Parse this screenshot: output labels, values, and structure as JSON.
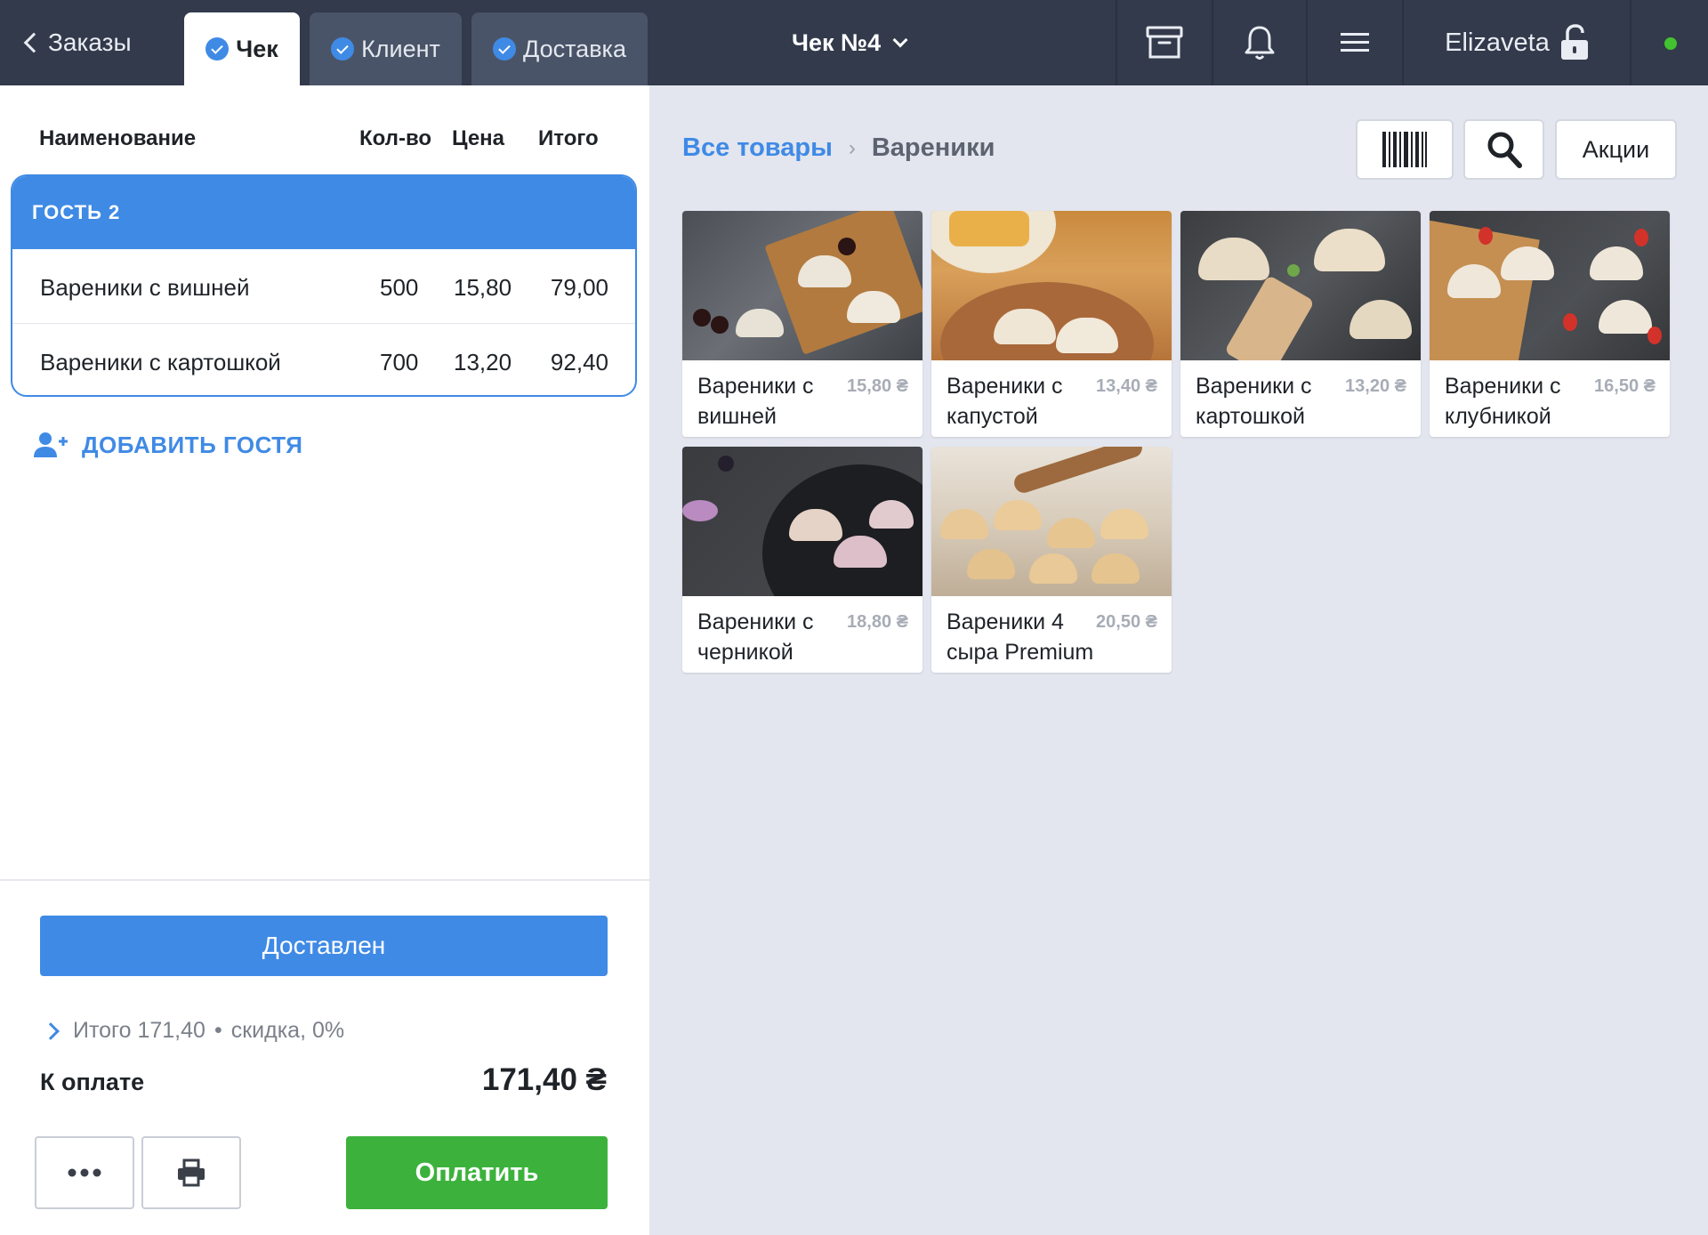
{
  "topbar": {
    "back_label": "Заказы",
    "tabs": [
      {
        "label": "Чек",
        "active": true
      },
      {
        "label": "Клиент",
        "active": false
      },
      {
        "label": "Доставка",
        "active": false
      }
    ],
    "document_title": "Чек №4",
    "user_name": "Elizaveta",
    "icons": [
      "archive-icon",
      "bell-icon",
      "menu-icon",
      "unlock-icon"
    ],
    "online_color": "#43c22f"
  },
  "order": {
    "columns": {
      "name": "Наименование",
      "qty": "Кол-во",
      "price": "Цена",
      "total": "Итого"
    },
    "guest_label": "ГОСТЬ 2",
    "items": [
      {
        "name": "Вареники с вишней",
        "qty": "500",
        "price": "15,80",
        "total": "79,00"
      },
      {
        "name": "Вареники с картошкой",
        "qty": "700",
        "price": "13,20",
        "total": "92,40"
      }
    ],
    "add_guest_label": "ДОБАВИТЬ ГОСТЯ",
    "status_button": "Доставлен",
    "summary": {
      "total_text": "Итого 171,40",
      "separator": "•",
      "discount_text": "скидка, 0%"
    },
    "to_pay_label": "К оплате",
    "to_pay_value": "171,40 ₴",
    "pay_button": "Оплатить"
  },
  "catalog": {
    "breadcrumb": {
      "root": "Все товары",
      "separator": "›",
      "current": "Вареники"
    },
    "promo_button": "Акции",
    "products": [
      {
        "name": "Вареники с вишней",
        "price": "15,80 ₴"
      },
      {
        "name": "Вареники с капустой",
        "price": "13,40 ₴"
      },
      {
        "name": "Вареники с картошкой",
        "price": "13,20 ₴"
      },
      {
        "name": "Вареники с клубникой",
        "price": "16,50 ₴"
      },
      {
        "name": "Вареники с черникой",
        "price": "18,80 ₴"
      },
      {
        "name": "Вареники 4 сыра Premium",
        "price": "20,50 ₴"
      }
    ]
  },
  "colors": {
    "topbar": "#323a4b",
    "accent_blue": "#3f8ae5",
    "pay_green": "#3cb23c",
    "catalog_bg": "#e3e6ef"
  }
}
